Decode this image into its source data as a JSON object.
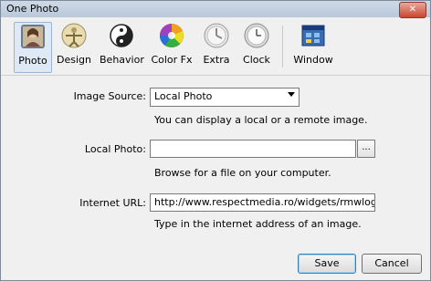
{
  "window": {
    "title": "One Photo",
    "close_glyph": "✕"
  },
  "toolbar": {
    "items": [
      {
        "label": "Photo",
        "icon": "photo-icon",
        "selected": true
      },
      {
        "label": "Design",
        "icon": "design-icon"
      },
      {
        "label": "Behavior",
        "icon": "behavior-icon"
      },
      {
        "label": "Color Fx",
        "icon": "color-fx-icon"
      },
      {
        "label": "Extra",
        "icon": "extra-icon"
      },
      {
        "label": "Clock",
        "icon": "clock-icon"
      },
      {
        "label": "Window",
        "icon": "window-icon"
      }
    ]
  },
  "form": {
    "image_source": {
      "label": "Image Source:",
      "value": "Local Photo",
      "hint": "You can display a local or a remote image."
    },
    "local_photo": {
      "label": "Local Photo:",
      "value": "",
      "browse_label": "...",
      "hint": "Browse for a file on your computer."
    },
    "internet_url": {
      "label": "Internet URL:",
      "value": "http://www.respectmedia.ro/widgets/rmwlog",
      "hint": "Type in the internet address of an image."
    }
  },
  "buttons": {
    "save": "Save",
    "cancel": "Cancel"
  }
}
